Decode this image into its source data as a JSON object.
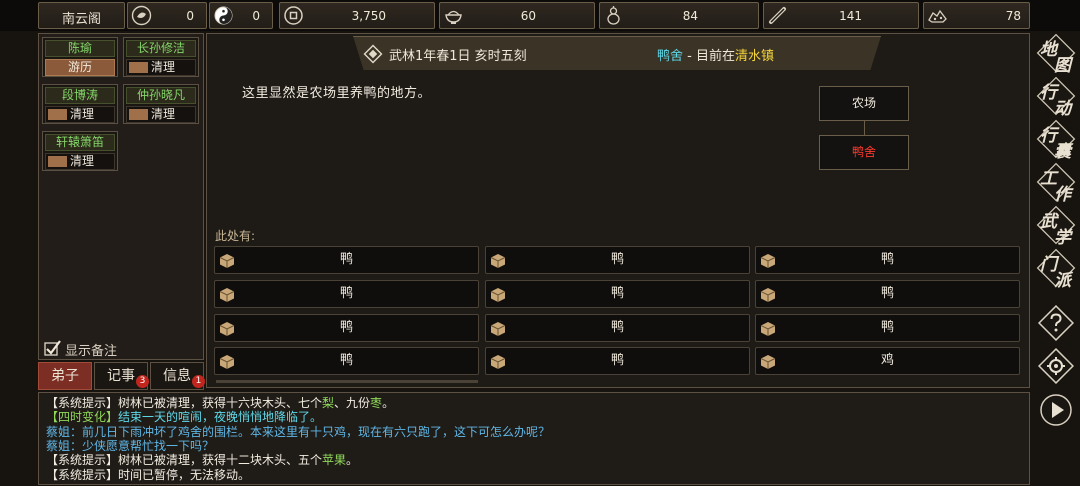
{
  "topbar": {
    "sect_name": "南云阁",
    "resources": [
      {
        "icon": "jade-pendant-icon",
        "value": "0"
      },
      {
        "icon": "yin-yang-icon",
        "value": "0"
      },
      {
        "icon": "copper-coin-icon",
        "value": "3,750"
      },
      {
        "icon": "rice-bowl-icon",
        "value": "60"
      },
      {
        "icon": "gourd-icon",
        "value": "84"
      },
      {
        "icon": "wood-log-icon",
        "value": "141"
      },
      {
        "icon": "ore-icon",
        "value": "78"
      }
    ]
  },
  "disciples": [
    {
      "name": "陈瑜",
      "task": "游历",
      "active": true
    },
    {
      "name": "长孙修洁",
      "task": "清理",
      "active": false
    },
    {
      "name": "段博涛",
      "task": "清理",
      "active": false
    },
    {
      "name": "仲孙晓凡",
      "task": "清理",
      "active": false
    },
    {
      "name": "轩辕箫笛",
      "task": "清理",
      "active": false
    }
  ],
  "show_note_label": "显示备注",
  "tabs": [
    {
      "label": "弟子",
      "badge": ""
    },
    {
      "label": "记事",
      "badge": "3"
    },
    {
      "label": "信息",
      "badge": "1"
    }
  ],
  "banner": {
    "date": "武林1年春1日 亥时五刻",
    "location_name": "鸭舍",
    "location_sep": " - 目前在",
    "town": "清水镇"
  },
  "description": "这里显然是农场里养鸭的地方。",
  "map": {
    "parent": "农场",
    "current": "鸭舍"
  },
  "here_label": "此处有:",
  "items": [
    {
      "name": "鸭"
    },
    {
      "name": "鸭"
    },
    {
      "name": "鸭"
    },
    {
      "name": "鸭"
    },
    {
      "name": "鸭"
    },
    {
      "name": "鸭"
    },
    {
      "name": "鸭"
    },
    {
      "name": "鸭"
    },
    {
      "name": "鸭"
    },
    {
      "name": "鸭"
    },
    {
      "name": "鸭"
    },
    {
      "name": "鸡"
    }
  ],
  "log": [
    {
      "parts": [
        {
          "t": "【系统提示】树林已被清理，获得十六块木头、七个",
          "c": "sys"
        },
        {
          "t": "梨",
          "c": "green"
        },
        {
          "t": "、九份",
          "c": "sys"
        },
        {
          "t": "枣",
          "c": "green"
        },
        {
          "t": "。",
          "c": "sys"
        }
      ]
    },
    {
      "parts": [
        {
          "t": "【四时变化】",
          "c": "green"
        },
        {
          "t": "结束一天的喧闹，夜晚悄悄地降临了。",
          "c": "sky"
        }
      ]
    },
    {
      "parts": [
        {
          "t": "蔡姐：前几日下雨冲坏了鸡舍的围栏。本来这里有十只鸡，现在有六只跑了，这下可怎么办呢？",
          "c": "name"
        }
      ]
    },
    {
      "parts": [
        {
          "t": "蔡姐：少侠愿意帮忙找一下吗？",
          "c": "name"
        }
      ]
    },
    {
      "parts": [
        {
          "t": "【系统提示】树林已被清理，获得十二块木头、五个",
          "c": "sys"
        },
        {
          "t": "苹果",
          "c": "green"
        },
        {
          "t": "。",
          "c": "sys"
        }
      ]
    },
    {
      "parts": [
        {
          "t": "【系统提示】时间已暂停，无法移动。",
          "c": "sys"
        }
      ]
    }
  ],
  "right_menu": [
    {
      "label": "地图",
      "icon": "map-menu-icon"
    },
    {
      "label": "行动",
      "icon": "action-menu-icon"
    },
    {
      "label": "行囊",
      "icon": "bag-menu-icon"
    },
    {
      "label": "工作",
      "icon": "work-menu-icon"
    },
    {
      "label": "武学",
      "icon": "martial-menu-icon"
    },
    {
      "label": "门派",
      "icon": "sect-menu-icon"
    }
  ]
}
